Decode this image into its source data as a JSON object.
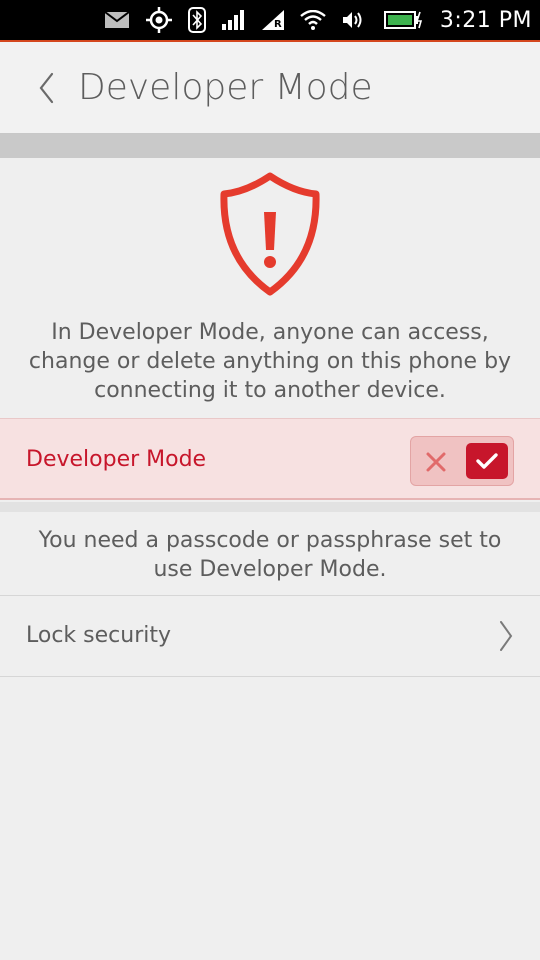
{
  "status_bar": {
    "time": "3:21 PM",
    "icons": [
      "mail-icon",
      "location-icon",
      "bluetooth-icon",
      "signal-icon",
      "roaming-icon",
      "wifi-icon",
      "volume-icon",
      "battery-icon"
    ],
    "roaming_letter": "R",
    "accent_color": "#d4471e"
  },
  "header": {
    "title": "Developer Mode",
    "back_icon": "back-chevron-icon"
  },
  "main": {
    "warning_icon": "shield-warning-icon",
    "warning_color": "#e53b2d",
    "warning_text": "In Developer Mode, anyone can access, change or delete anything on this phone by connecting it to another device.",
    "developer_mode": {
      "label": "Developer Mode",
      "enabled": true,
      "accent_color": "#c7162b"
    },
    "passcode_note": "You need a passcode or passphrase set to use Developer Mode.",
    "lock_security": {
      "label": "Lock security",
      "icon": "chevron-right-icon"
    }
  }
}
